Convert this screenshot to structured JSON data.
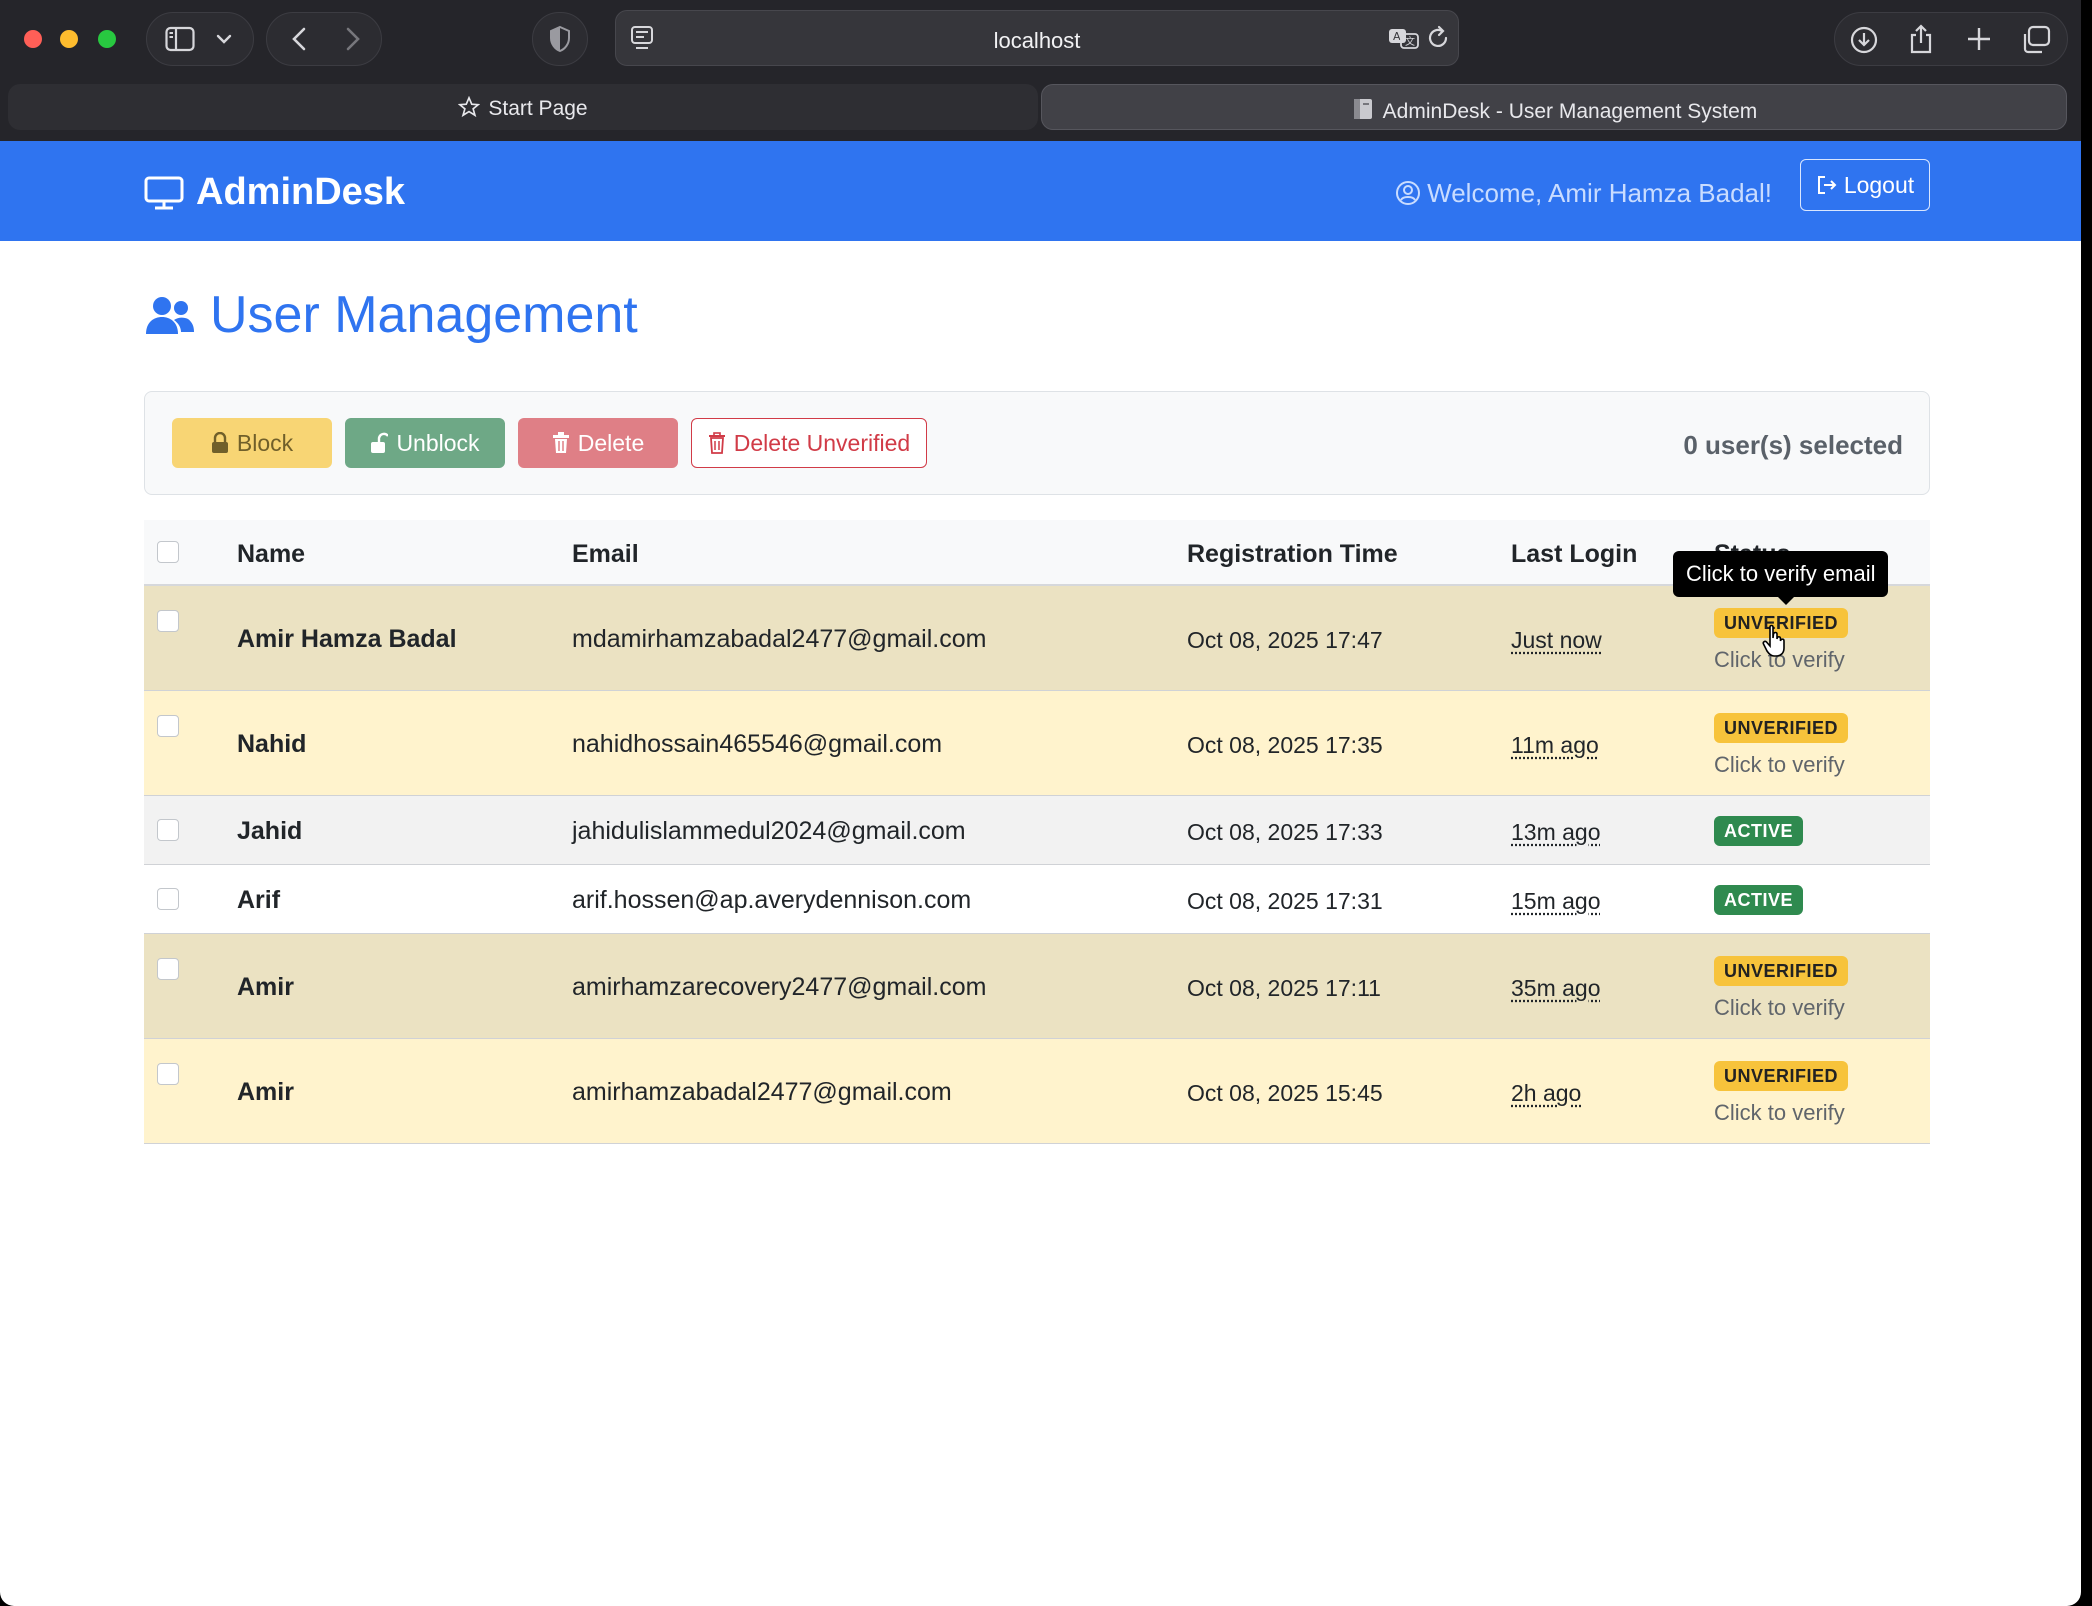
{
  "browser": {
    "address": "localhost",
    "tabs": [
      {
        "label": "Start Page",
        "active": false
      },
      {
        "label": "AdminDesk - User Management System",
        "active": true
      }
    ]
  },
  "navbar": {
    "brand": "AdminDesk",
    "welcome": "Welcome, Amir Hamza Badal!",
    "logout_label": "Logout",
    "color": "#2f74f0"
  },
  "page": {
    "title": "User Management"
  },
  "actions": {
    "block_label": "Block",
    "unblock_label": "Unblock",
    "delete_label": "Delete",
    "delete_unverified_label": "Delete Unverified",
    "selected_count": "0 user(s) selected"
  },
  "table": {
    "columns": [
      "Name",
      "Email",
      "Registration Time",
      "Last Login",
      "Status"
    ],
    "rows": [
      {
        "name": "Amir Hamza Badal",
        "email": "mdamirhamzabadal2477@gmail.com",
        "registered": "Oct 08, 2025 17:47",
        "last_login": "Just now",
        "status": "UNVERIFIED",
        "hint": "Click to verify"
      },
      {
        "name": "Nahid",
        "email": "nahidhossain465546@gmail.com",
        "registered": "Oct 08, 2025 17:35",
        "last_login": "11m ago",
        "status": "UNVERIFIED",
        "hint": "Click to verify"
      },
      {
        "name": "Jahid",
        "email": "jahidulislammedul2024@gmail.com",
        "registered": "Oct 08, 2025 17:33",
        "last_login": "13m ago",
        "status": "ACTIVE"
      },
      {
        "name": "Arif",
        "email": "arif.hossen@ap.averydennison.com",
        "registered": "Oct 08, 2025 17:31",
        "last_login": "15m ago",
        "status": "ACTIVE"
      },
      {
        "name": "Amir",
        "email": "amirhamzarecovery2477@gmail.com",
        "registered": "Oct 08, 2025 17:11",
        "last_login": "35m ago",
        "status": "UNVERIFIED",
        "hint": "Click to verify"
      },
      {
        "name": "Amir",
        "email": "amirhamzabadal2477@gmail.com",
        "registered": "Oct 08, 2025 15:45",
        "last_login": "2h ago",
        "status": "UNVERIFIED",
        "hint": "Click to verify"
      }
    ]
  },
  "tooltip": {
    "text": "Click to verify email"
  },
  "colors": {
    "unverified_badge": "#f7c33b",
    "active_badge": "#2f8a4f",
    "unverified_row": "#fff3cd"
  }
}
